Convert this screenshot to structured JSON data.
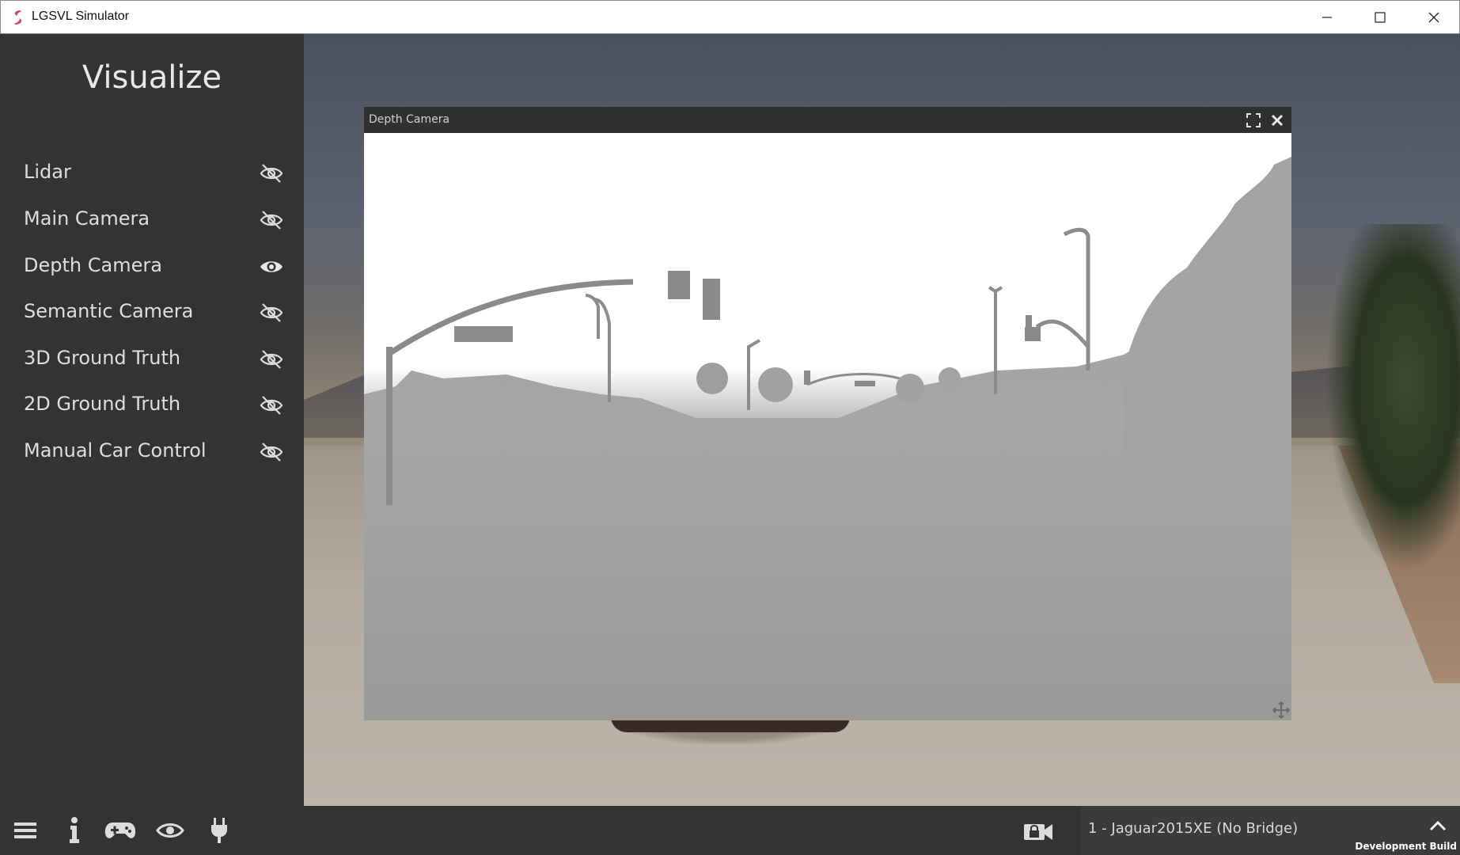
{
  "window": {
    "title": "LGSVL Simulator"
  },
  "sidebar": {
    "title": "Visualize",
    "items": [
      {
        "label": "Lidar",
        "icon": "eye-hidden-icon"
      },
      {
        "label": "Main Camera",
        "icon": "eye-hidden-icon"
      },
      {
        "label": "Depth Camera",
        "icon": "eye-icon"
      },
      {
        "label": "Semantic Camera",
        "icon": "eye-hidden-icon"
      },
      {
        "label": "3D Ground Truth",
        "icon": "eye-hidden-icon"
      },
      {
        "label": "2D Ground Truth",
        "icon": "eye-hidden-icon"
      },
      {
        "label": "Manual Car Control",
        "icon": "eye-hidden-icon"
      }
    ]
  },
  "depth_window": {
    "title": "Depth Camera"
  },
  "bottombar": {
    "icons": [
      "menu-icon",
      "info-icon",
      "gamepad-icon",
      "eye-icon",
      "plug-icon",
      "camera-lock-icon"
    ],
    "vehicle": "1 - Jaguar2015XE (No Bridge)",
    "build": "Development Build"
  },
  "colors": {
    "panel": "#333333",
    "accent": "#e0445a"
  }
}
